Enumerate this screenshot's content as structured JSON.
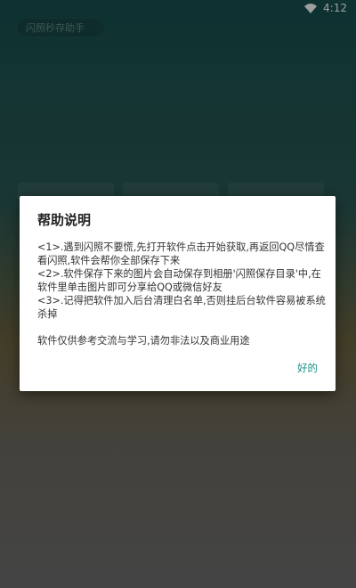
{
  "status_bar": {
    "time": "4:12",
    "icons": [
      "wifi-icon"
    ]
  },
  "app": {
    "title": "闪照秒存助手"
  },
  "dialog": {
    "title": "帮助说明",
    "items": [
      "<1>.遇到闪照不要慌,先打开软件点击开始获取,再返回QQ尽情查看闪照,软件会帮你全部保存下来",
      "<2>.软件保存下来的图片会自动保存到相册'闪照保存目录'中,在软件里单击图片即可分享给QQ或微信好友",
      "<3>.记得把软件加入后台清理白名单,否则挂后台软件容易被系统杀掉"
    ],
    "note": "软件仅供参考交流与学习,请勿非法以及商业用途",
    "ok_label": "好的"
  },
  "colors": {
    "accent": "#1a8f86",
    "background_top": "#16524f",
    "background_bottom": "#6f6f6f",
    "dialog_bg": "#ffffff"
  }
}
